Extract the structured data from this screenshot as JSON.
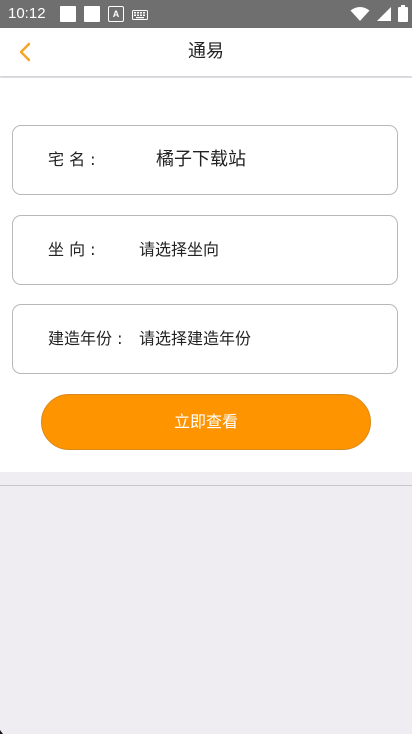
{
  "status_bar": {
    "time": "10:12",
    "keyboard_icon": "keyboard-icon",
    "a_icon_label": "A"
  },
  "header": {
    "title": "通易",
    "back_icon": "chevron-left-icon"
  },
  "form": {
    "house_name": {
      "label": "宅 名 :",
      "value": "橘子下载站"
    },
    "orientation": {
      "label": "坐 向 :",
      "placeholder": "请选择坐向"
    },
    "build_year": {
      "label": "建造年份 :",
      "placeholder": "请选择建造年份"
    },
    "submit_label": "立即查看"
  },
  "colors": {
    "accent": "#fd9400",
    "back_icon": "#f5a623",
    "status_bar": "#6f6f6f"
  }
}
